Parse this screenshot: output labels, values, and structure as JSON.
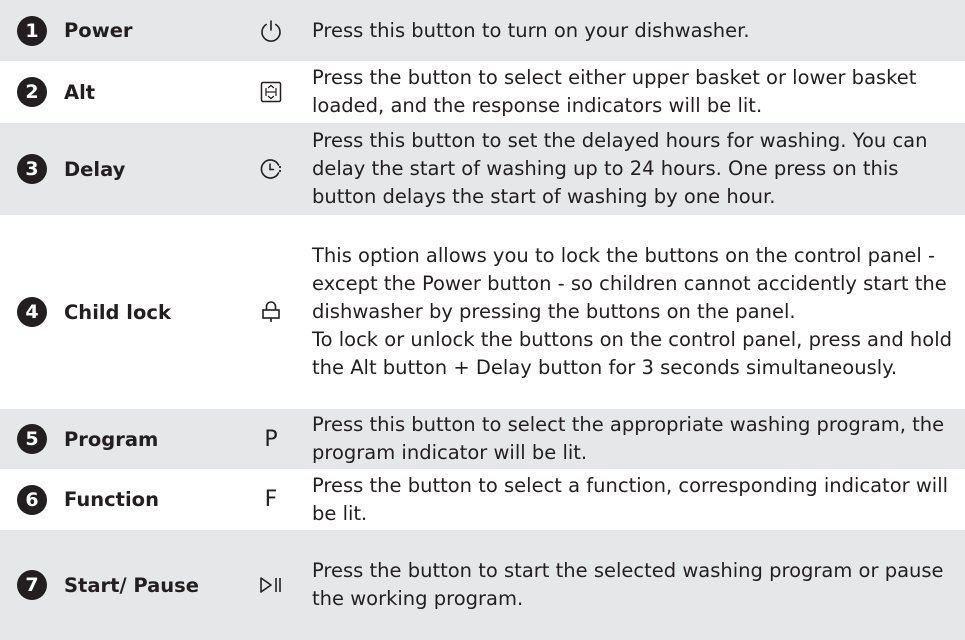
{
  "rows": [
    {
      "number": "1",
      "name": "Power",
      "icon": "power-icon",
      "description": "Press this button to turn on your dishwasher."
    },
    {
      "number": "2",
      "name": "Alt",
      "icon": "basket-select-icon",
      "description": "Press the button to select either upper basket or lower basket loaded, and the response indicators will be lit."
    },
    {
      "number": "3",
      "name": "Delay",
      "icon": "delay-clock-icon",
      "description": "Press this button to set the delayed hours for washing. You can delay the start of washing up to 24 hours. One press on this button delays the start of washing by one hour."
    },
    {
      "number": "4",
      "name": "Child lock",
      "icon": "lock-icon",
      "description": "This option allows you to lock the buttons on the control panel - except the Power button - so children cannot accidently start the dishwasher by pressing the buttons on the panel.",
      "description_2": "To lock or unlock the buttons on the control panel, press and hold the Alt button + Delay button for 3 seconds simultaneously."
    },
    {
      "number": "5",
      "name": "Program",
      "icon_text": "P",
      "description": "Press this button to select the appropriate washing program, the program indicator will be lit."
    },
    {
      "number": "6",
      "name": "Function",
      "icon_text": "F",
      "description": "Press the button to select a function, corresponding indicator will be lit."
    },
    {
      "number": "7",
      "name": "Start/ Pause",
      "icon": "play-pause-icon",
      "description": "Press the button to start the selected washing program or pause the working program."
    }
  ],
  "colors": {
    "shaded_row": "#e6e7e8",
    "text": "#231f20",
    "badge_fill": "#231f20"
  }
}
